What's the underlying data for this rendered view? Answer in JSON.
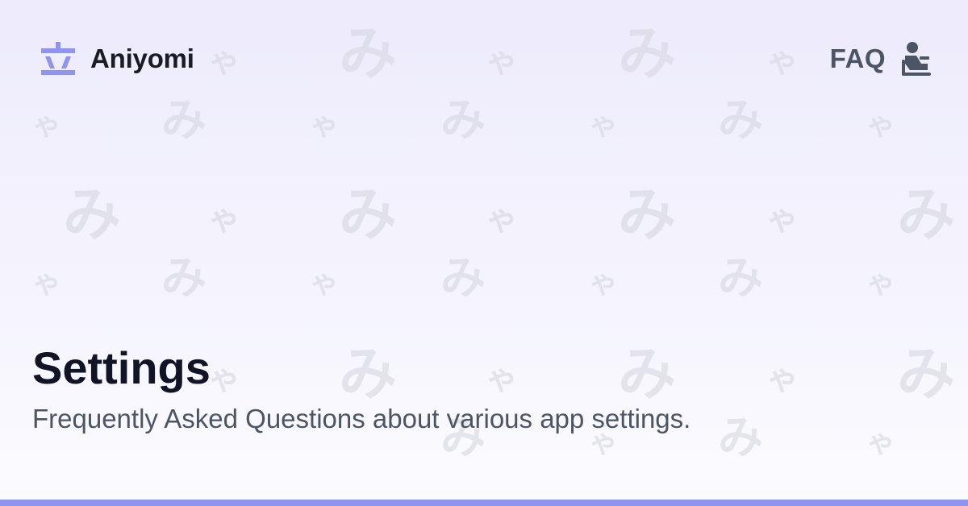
{
  "brand": {
    "name": "Aniyomi",
    "logo_icon": "aniyomi-logo-icon"
  },
  "nav": {
    "section_label": "FAQ",
    "section_icon": "reader-person-icon"
  },
  "page": {
    "title": "Settings",
    "description": "Frequently Asked Questions about various app settings."
  },
  "colors": {
    "accent": "#8f94ef",
    "title_text": "#111426",
    "muted_text": "#4b5565",
    "pattern": "#d4d4de"
  }
}
